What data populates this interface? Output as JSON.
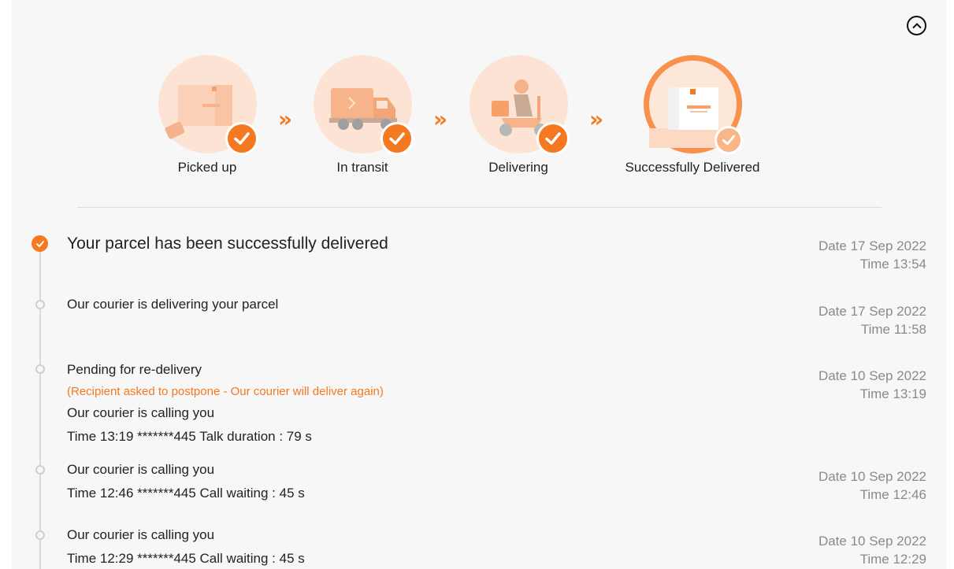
{
  "header": {
    "collapse_icon": "chevron-up-icon"
  },
  "steps": [
    {
      "label": "Picked up",
      "icon": "parcel-pickup-icon",
      "done": true
    },
    {
      "label": "In transit",
      "icon": "truck-icon",
      "done": true
    },
    {
      "label": "Delivering",
      "icon": "courier-scooter-icon",
      "done": true
    },
    {
      "label": "Successfully Delivered",
      "icon": "delivered-box-icon",
      "done": true,
      "current": true
    }
  ],
  "step_arrow": "»",
  "colors": {
    "accent": "#f47920",
    "accent_light": "#fde3d3",
    "muted": "#8a8a8a"
  },
  "events": [
    {
      "title": "Your parcel has been successfully delivered",
      "date": "Date 17 Sep 2022",
      "time": "Time 13:54"
    },
    {
      "title": "Our courier is delivering your parcel",
      "date": "Date 17 Sep 2022",
      "time": "Time 11:58"
    },
    {
      "title": "Pending for re-delivery",
      "note": "(Recipient asked to postpone - Our courier will deliver again)",
      "line1": "Our courier is calling you",
      "line2": "Time 13:19 *******445 Talk duration : 79 s",
      "date": "Date 10 Sep 2022",
      "time": "Time 13:19"
    },
    {
      "title": "Our courier is calling you",
      "line1": "Time 12:46 *******445 Call waiting : 45 s",
      "date": "Date 10 Sep 2022",
      "time": "Time 12:46"
    },
    {
      "title": "Our courier is calling you",
      "line1": "Time 12:29 *******445 Call waiting : 45 s",
      "date": "Date 10 Sep 2022",
      "time": "Time 12:29"
    }
  ]
}
